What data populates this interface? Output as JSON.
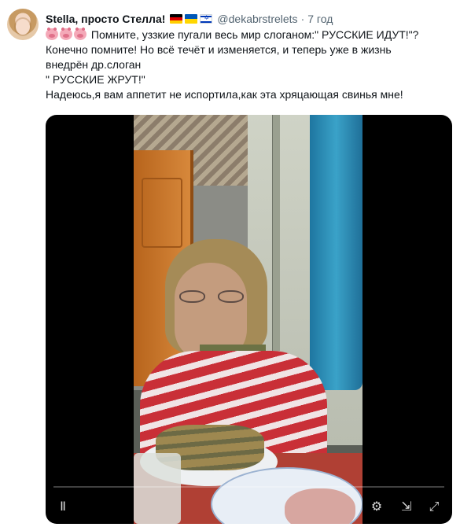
{
  "tweet": {
    "author_name": "Stella, просто Стелла!",
    "handle": "@dekabrstrelets",
    "separator": "·",
    "time": "7 год",
    "flags": [
      "germany-flag",
      "ukraine-flag",
      "israel-flag"
    ],
    "text": {
      "line1": "Помните, уззкие пугали весь мир слоганом:\" РУССКИЕ ИДУТ!\"?",
      "line2": "Конечно помните! Но всё течёт и изменяется, и теперь уже в жизнь",
      "line3": "внедрён др.слоган",
      "line4": "\" РУССКИЕ ЖРУТ!\"",
      "line5": "Надеюсь,я вам аппетит не испортила,как эта хряцающая свинья мне!"
    },
    "emoji": [
      "pig-face-emoji",
      "pig-face-emoji",
      "pig-face-emoji"
    ]
  },
  "video": {
    "state": "paused",
    "icons": [
      "pause-icon",
      "settings-gear-icon",
      "picture-in-picture-icon",
      "fullscreen-icon"
    ]
  }
}
